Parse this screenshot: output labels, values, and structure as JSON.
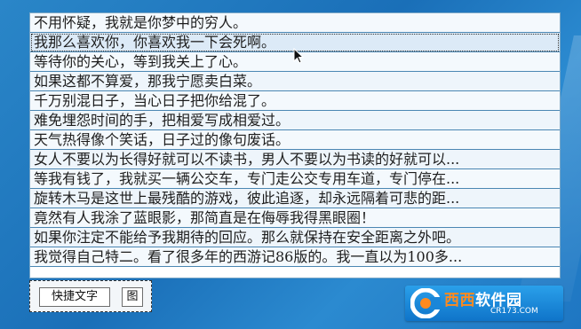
{
  "phrases": [
    "不用怀疑，我就是你梦中的穷人。",
    "我那么喜欢你，你喜欢我一下会死啊。",
    "等待你的关心，等到我关上了心。",
    "如果这都不算爱，那我宁愿卖白菜。",
    "千万别混日子，当心日子把你给混了。",
    "难免埋怨时间的手，把相爱写成相爱过。",
    "天气热得像个笑话，日子过的像句废话。",
    "女人不要以为长得好就可以不读书，男人不要以为书读的好就可以...",
    "等我有钱了，我就买一辆公交车，专门走公交专用车道，专门停在...",
    "旋转木马是这世上最残酷的游戏，彼此追逐，却永远隔着可悲的距...",
    "竟然有人我涂了蓝眼影，那简直是在侮辱我得黑眼圈！",
    "如果你注定不能给予我期待的回应。那么就保持在安全距离之外吧。",
    "我觉得自己特二。看了很多年的西游记86版的。我一直以为100多..."
  ],
  "toolbar": {
    "quick_text_label": "快捷文字",
    "image_label": "图"
  },
  "watermark": {
    "brand_a": "西西",
    "brand_b": "软件园",
    "url": "CR173.COM"
  },
  "colors": {
    "row_border": "#4b87b3",
    "row_hover": "#dceaf7",
    "desktop": "#1a6fb8",
    "watermark_accent": "#ff8a1e"
  }
}
